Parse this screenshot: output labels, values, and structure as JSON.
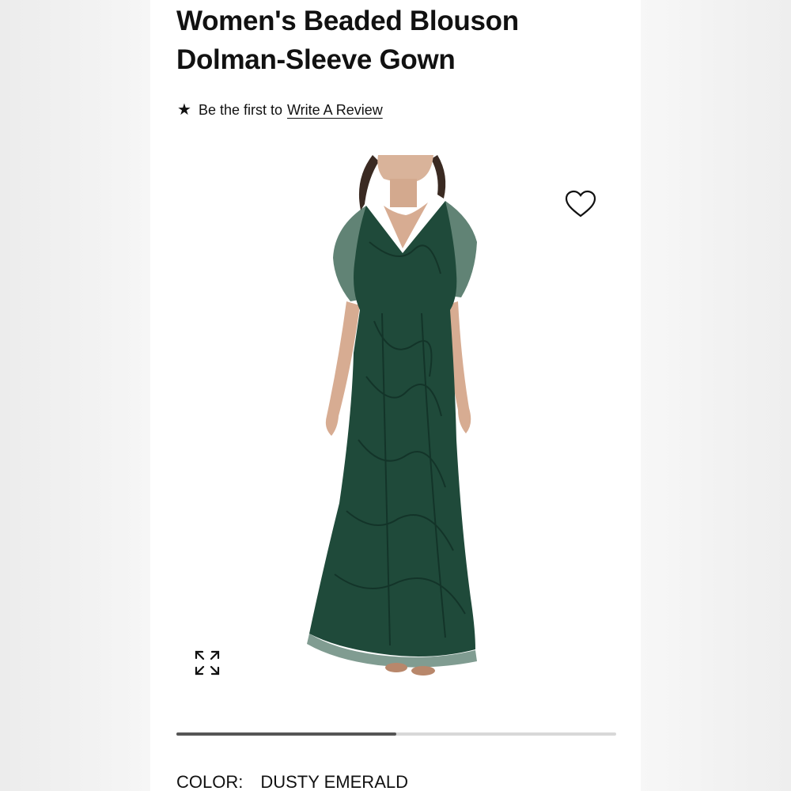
{
  "product": {
    "title_line1": "Women's Beaded Blouson",
    "title_line2": "Dolman-Sleeve Gown"
  },
  "review": {
    "star_icon": "★",
    "prefix": "Be the first to",
    "link_label": "Write A Review"
  },
  "gallery": {
    "progress": 0.5,
    "dress_color": "#1f4a3a",
    "icons": [
      "heart-icon",
      "expand-icon"
    ]
  },
  "color_selector": {
    "label": "COLOR:",
    "value": "DUSTY EMERALD"
  }
}
